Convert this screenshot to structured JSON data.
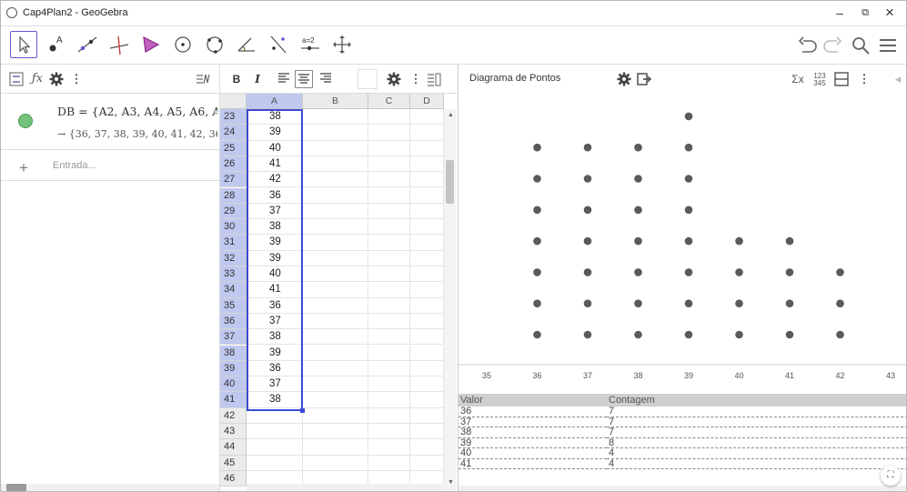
{
  "window": {
    "title": "Cap4Plan2 - GeoGebra",
    "minimize": "–",
    "restore": "⧉",
    "close": "×"
  },
  "toolbar": {
    "tools": [
      "move-tool",
      "point-tool",
      "line-tool",
      "perpendicular-tool",
      "polygon-tool",
      "circle-center-tool",
      "circle-3points-tool",
      "angle-tool",
      "reflect-tool",
      "slider-tool",
      "move-view-tool"
    ],
    "slider_label": "a=2",
    "right": [
      "undo",
      "redo",
      "search",
      "menu"
    ]
  },
  "algebra": {
    "definition": "DB = {A2, A3, A4, A5, A6, A7, A8",
    "value": "→ {36, 37, 38, 39, 40, 41, 42, 36, 3",
    "input_placeholder": "Entrada...",
    "icon_color": "#73c27b"
  },
  "sheet": {
    "toolbar": {
      "bold": "B",
      "italic": "I"
    },
    "columns": [
      "A",
      "B",
      "C",
      "D"
    ],
    "rows": [
      {
        "n": "23",
        "a": "38"
      },
      {
        "n": "24",
        "a": "39"
      },
      {
        "n": "25",
        "a": "40"
      },
      {
        "n": "26",
        "a": "41"
      },
      {
        "n": "27",
        "a": "42"
      },
      {
        "n": "28",
        "a": "36"
      },
      {
        "n": "29",
        "a": "37"
      },
      {
        "n": "30",
        "a": "38"
      },
      {
        "n": "31",
        "a": "39"
      },
      {
        "n": "32",
        "a": "39"
      },
      {
        "n": "33",
        "a": "40"
      },
      {
        "n": "34",
        "a": "41"
      },
      {
        "n": "35",
        "a": "36"
      },
      {
        "n": "36",
        "a": "37"
      },
      {
        "n": "37",
        "a": "38"
      },
      {
        "n": "38",
        "a": "39"
      },
      {
        "n": "39",
        "a": "36"
      },
      {
        "n": "40",
        "a": "37"
      },
      {
        "n": "41",
        "a": "38"
      },
      {
        "n": "42",
        "a": ""
      },
      {
        "n": "43",
        "a": ""
      },
      {
        "n": "44",
        "a": ""
      },
      {
        "n": "45",
        "a": ""
      },
      {
        "n": "46",
        "a": ""
      }
    ]
  },
  "graphics": {
    "plot_type": "Diagrama de Pontos",
    "table_headers": {
      "value": "Valor",
      "count": "Contagem"
    },
    "table_rows": [
      {
        "v": "36",
        "c": "7"
      },
      {
        "v": "37",
        "c": "7"
      },
      {
        "v": "38",
        "c": "7"
      },
      {
        "v": "39",
        "c": "8"
      },
      {
        "v": "40",
        "c": "4"
      },
      {
        "v": "41",
        "c": "4"
      }
    ]
  },
  "chart_data": {
    "type": "scatter",
    "title": "",
    "xlabel": "",
    "ylabel": "",
    "x_ticks": [
      35,
      36,
      37,
      38,
      39,
      40,
      41,
      42,
      43
    ],
    "xlim": [
      35,
      43
    ],
    "values": [
      36,
      37,
      38,
      39,
      40,
      41,
      42
    ],
    "counts": [
      7,
      7,
      7,
      8,
      4,
      4,
      3
    ],
    "grid": false,
    "dot_color": "#5a5a5a"
  }
}
